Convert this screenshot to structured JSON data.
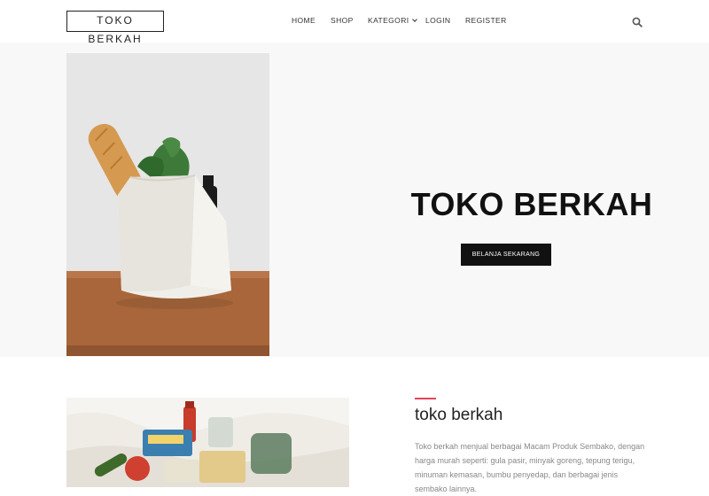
{
  "header": {
    "logo": "TOKO BERKAH",
    "nav": {
      "home": "HOME",
      "shop": "SHOP",
      "kategori": "KATEGORI",
      "login": "LOGIN",
      "register": "REGISTER"
    },
    "search_icon": "search-icon"
  },
  "hero": {
    "title": "TOKO BERKAH",
    "button_label": "BELANJA SEKARANG",
    "image": "shopping-bag-photo"
  },
  "about": {
    "title": "toko berkah",
    "accent_color": "#e0455e",
    "text": "Toko berkah menjual berbagai Macam Produk Sembako, dengan harga murah seperti: gula pasir, minyak goreng, tepung terigu, minuman kemasan, bumbu penyedap, dan berbagai jenis sembako lainnya.",
    "image": "groceries-photo"
  },
  "colors": {
    "hero_background": "#f8f8f8",
    "button_background": "#111111",
    "text_muted": "#888888"
  }
}
